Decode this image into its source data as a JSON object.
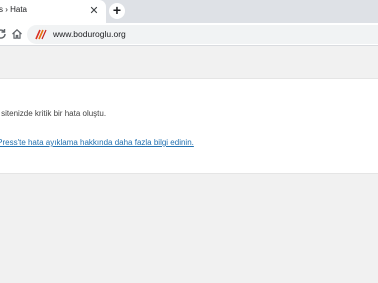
{
  "browser": {
    "tab": {
      "title": "ss › Hata",
      "close_icon": "close-icon"
    },
    "new_tab_icon": "plus-icon",
    "toolbar": {
      "reload_icon": "reload-icon",
      "home_icon": "home-icon",
      "site_icon": "wordpress-site-icon",
      "url": "www.boduroglu.org"
    }
  },
  "page": {
    "message": "eb sitenizde kritik bir hata oluştu.",
    "link_text": "rdPress'te hata ayıklama hakkında daha fazla bilgi edinin."
  },
  "colors": {
    "chrome": "#dee1e6",
    "link": "#2271b1",
    "page_bg": "#f1f1f1"
  }
}
